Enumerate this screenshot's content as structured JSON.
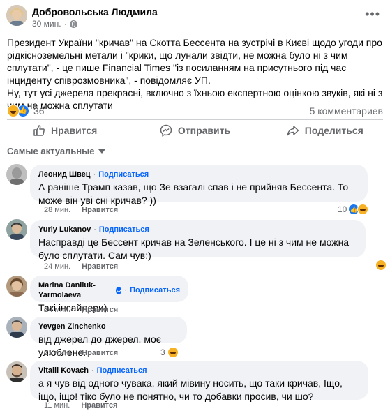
{
  "post": {
    "author": "Добровольська Людмила",
    "time": "30 мин.",
    "paragraph1": "Президент України \"кричав\" на Скотта Бессента на зустрічі в Києві щодо угоди про рідкісноземельні метали і \"крики, що лунали звідти, не можна було ні з чим сплутати\", - це пише Financial Times \"із посиланням на присутнього під час інциденту співрозмовника\", - повідомляє УП.",
    "paragraph2": "Ну, тут усі джерела прекрасні, включно з їхньою експертною  оцінкою  звуків, які ні з чим не можна сплутати",
    "reaction_count": "36",
    "comments_count": "5 комментариев"
  },
  "actions": {
    "like": "Нравится",
    "send": "Отправить",
    "share": "Поделиться"
  },
  "sort_label": "Самые актуальные",
  "follow_label": "Подписаться",
  "like_label": "Нравится",
  "comments": [
    {
      "name": "Леонид Швец",
      "text": "А раніше Трамп казав, що Зе взагалі спав і не прийняв Бессента. То може він уві сні кричав? ))",
      "time": "28 мин.",
      "reactions": "10"
    },
    {
      "name": "Yuriy Lukanov",
      "text": "Насправді це Бессент кричав на Зеленського. І це ні з чим не можна було сплутати. Сам чув:)",
      "time": "24 мин."
    },
    {
      "name": "Marina Daniluk-Yarmolaeva",
      "text": "Такі інсайдери)",
      "time": "24 мин."
    },
    {
      "name": "Yevgen Zinchenko",
      "text": "від джерел до джерел. моє улюблене.",
      "time": "21 мин.",
      "reactions": "3"
    },
    {
      "name": "Vitalii Kovach",
      "text": "а я чув від одного чувака, який мівину носить, що таки кричав, Іщо, іщо, іщо! тіко було не понятно, чи то добавки просив, чи шо?",
      "time": "11 мин."
    }
  ],
  "colors": {
    "link": "#0866ff",
    "secondary_text": "#65676b",
    "bubble": "#f0f2f5"
  }
}
